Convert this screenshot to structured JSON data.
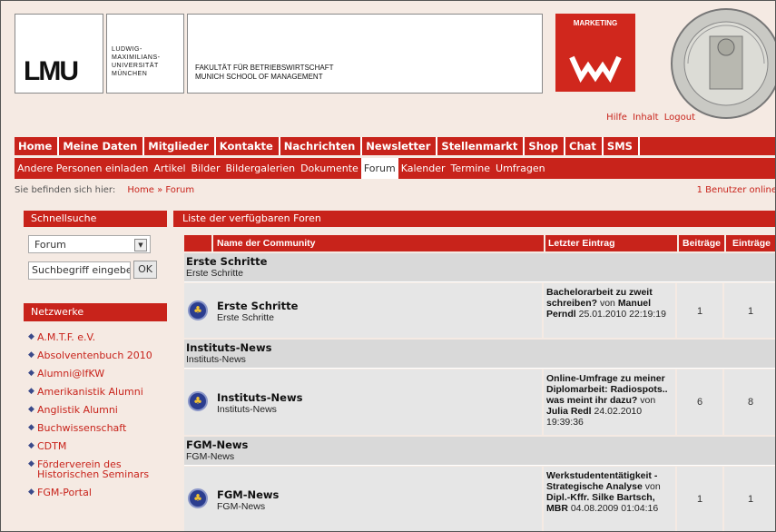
{
  "header": {
    "logo": "LMU",
    "university": [
      "LUDWIG-",
      "MAXIMILIANS-",
      "UNIVERSITÄT",
      "MÜNCHEN"
    ],
    "faculty": [
      "FAKULTÄT FÜR BETRIEBSWIRTSCHAFT",
      "MUNICH SCHOOL OF MANAGEMENT"
    ],
    "marketing": "MARKETING",
    "links": [
      "Hilfe",
      "Inhalt",
      "Logout"
    ]
  },
  "nav_main": [
    "Home",
    "Meine Daten",
    "Mitglieder",
    "Kontakte",
    "Nachrichten",
    "Newsletter",
    "Stellenmarkt",
    "Shop",
    "Chat",
    "SMS"
  ],
  "nav_sub": [
    "Andere Personen einladen",
    "Artikel",
    "Bilder",
    "Bildergalerien",
    "Dokumente",
    "Forum",
    "Kalender",
    "Termine",
    "Umfragen"
  ],
  "breadcrumb": {
    "label": "Sie befinden sich hier:",
    "path": "Home » Forum",
    "online": "1 Benutzer online"
  },
  "sidebar": {
    "search_title": "Schnellsuche",
    "select_value": "Forum",
    "search_placeholder": "Suchbegriff eingeben",
    "ok": "OK",
    "networks_title": "Netzwerke",
    "networks": [
      "A.M.T.F. e.V.",
      "Absolventenbuch 2010",
      "Alumni@IfKW",
      "Amerikanistik Alumni",
      "Anglistik Alumni",
      "Buchwissenschaft",
      "CDTM",
      "Förderverein des Historischen Seminars",
      "FGM-Portal"
    ]
  },
  "main": {
    "title": "Liste der verfügbaren Foren",
    "columns": [
      "Name der Community",
      "Letzter Eintrag",
      "Beiträge",
      "Einträge"
    ],
    "categories": [
      {
        "name": "Erste Schritte",
        "sub": "Erste Schritte",
        "forum": {
          "name": "Erste Schritte",
          "sub": "Erste Schritte",
          "last_title": "Bachelorarbeit zu zweit schreiben?",
          "by": "von",
          "author": "Manuel Perndl",
          "date": "25.01.2010 22:19:19",
          "beitraege": "1",
          "eintraege": "1"
        }
      },
      {
        "name": "Instituts-News",
        "sub": "Instituts-News",
        "forum": {
          "name": "Instituts-News",
          "sub": "Instituts-News",
          "last_title": "Online-Umfrage zu meiner Diplomarbeit: Radiospots.. was meint ihr dazu?",
          "by": "von",
          "author": "Julia Redl",
          "date": "24.02.2010 19:39:36",
          "beitraege": "6",
          "eintraege": "8"
        }
      },
      {
        "name": "FGM-News",
        "sub": "FGM-News",
        "forum": {
          "name": "FGM-News",
          "sub": "FGM-News",
          "last_title": "Werkstudententätigkeit - Strategische Analyse",
          "by": "von",
          "author": "Dipl.-Kffr. Silke Bartsch, MBR",
          "date": "04.08.2009 01:04:16",
          "beitraege": "1",
          "eintraege": "1"
        }
      }
    ]
  }
}
